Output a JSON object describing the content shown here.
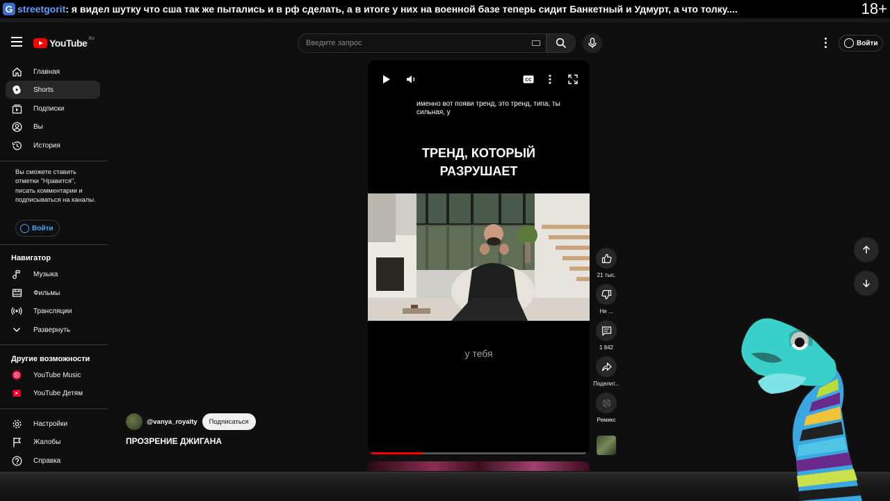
{
  "overlay": {
    "logo_letter": "G",
    "username": "streetgorit",
    "message": ": я видел шутку что сша так же пытались и в рф сделать, а в итоге у них на военной базе теперь сидит Банкетный и Удмурт, а что толку....",
    "age_rating": "18+"
  },
  "masthead": {
    "logo_text": "YouTube",
    "region": "RU",
    "search_placeholder": "Введите запрос",
    "signin_label": "Войти"
  },
  "sidebar": {
    "main": [
      {
        "label": "Главная",
        "icon": "home-icon"
      },
      {
        "label": "Shorts",
        "icon": "shorts-icon"
      },
      {
        "label": "Подписки",
        "icon": "subscriptions-icon"
      },
      {
        "label": "Вы",
        "icon": "you-icon"
      },
      {
        "label": "История",
        "icon": "history-icon"
      }
    ],
    "signin_note": "Вы сможете ставить отметки \"Нравится\", писать комментарии и подписываться на каналы.",
    "signin_label": "Войти",
    "navigator_title": "Навигатор",
    "navigator": [
      {
        "label": "Музыка",
        "icon": "music-icon"
      },
      {
        "label": "Фильмы",
        "icon": "film-icon"
      },
      {
        "label": "Трансляции",
        "icon": "live-icon"
      },
      {
        "label": "Развернуть",
        "icon": "chevron-down-icon"
      }
    ],
    "other_title": "Другие возможности",
    "other": [
      {
        "label": "YouTube Music",
        "icon": "youtube-music-icon"
      },
      {
        "label": "YouTube Детям",
        "icon": "youtube-kids-icon"
      }
    ],
    "footer": [
      {
        "label": "Настройки",
        "icon": "gear-icon"
      },
      {
        "label": "Жалобы",
        "icon": "flag-icon"
      },
      {
        "label": "Справка",
        "icon": "help-icon"
      }
    ]
  },
  "player": {
    "caption_line": "именно вот появи тренд, это тренд, типа, ты сильная, у",
    "title_line1": "ТРЕНД, КОТОРЫЙ",
    "title_line2": "РАЗРУШАЕТ",
    "subtitle_word": "у тебя",
    "progress": 0.24
  },
  "channel": {
    "handle": "@vanya_royalty",
    "subscribe_label": "Подписаться",
    "video_title": "ПРОЗРЕНИЕ ДЖИГАНА"
  },
  "actions": {
    "likes": "21 тыс.",
    "dislike": "Не ...",
    "comments": "1 842",
    "share": "Поделит...",
    "remix": "Ремикс"
  },
  "colors": {
    "background": "#0f0f0f",
    "accent_red": "#ff0000",
    "link_blue": "#3ea6ff",
    "active_item": "#272727"
  }
}
